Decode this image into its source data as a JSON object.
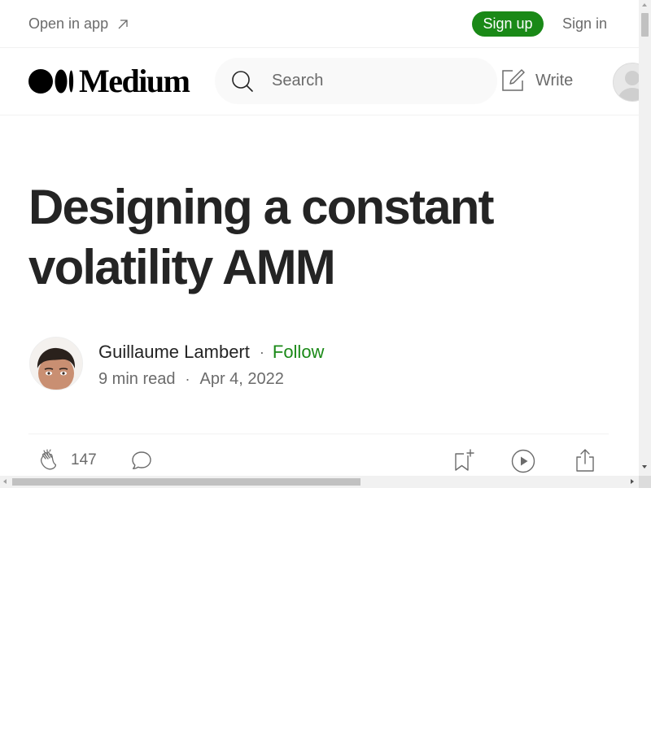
{
  "topbar": {
    "open_in_app": "Open in app",
    "sign_up": "Sign up",
    "sign_in": "Sign in"
  },
  "header": {
    "logo_text": "Medium",
    "search_placeholder": "Search",
    "write_label": "Write"
  },
  "article": {
    "title": "Designing a constant volatility AMM",
    "author": "Guillaume Lambert",
    "separator": "·",
    "follow_label": "Follow",
    "read_time": "9 min read",
    "date": "Apr 4, 2022",
    "clap_count": "147"
  },
  "colors": {
    "accent_green": "#1a8917",
    "text_primary": "#242424",
    "text_secondary": "#6b6b6b"
  },
  "icons": {
    "open_in_app": "arrow-up-right-icon",
    "search": "search-icon",
    "write": "write-icon",
    "clap": "clap-icon",
    "comment": "comment-icon",
    "save": "bookmark-add-icon",
    "listen": "play-circle-icon",
    "share": "share-icon"
  }
}
